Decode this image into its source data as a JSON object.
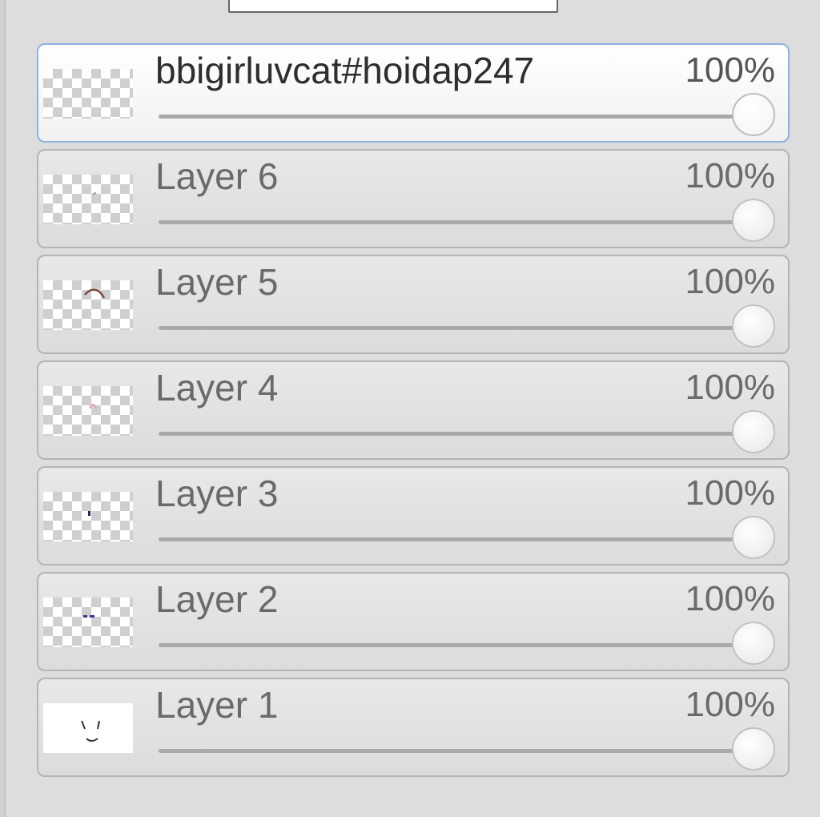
{
  "layers_panel": {
    "layers": [
      {
        "name": "bbigirluvcat#hoidap247",
        "opacity_label": "100%",
        "opacity": 1.0,
        "active": true,
        "thumb_icon": "empty-transparent"
      },
      {
        "name": "Layer 6",
        "opacity_label": "100%",
        "opacity": 1.0,
        "active": false,
        "thumb_icon": "tiny-mark"
      },
      {
        "name": "Layer 5",
        "opacity_label": "100%",
        "opacity": 1.0,
        "active": false,
        "thumb_icon": "brown-stroke"
      },
      {
        "name": "Layer 4",
        "opacity_label": "100%",
        "opacity": 1.0,
        "active": false,
        "thumb_icon": "pink-stroke"
      },
      {
        "name": "Layer 3",
        "opacity_label": "100%",
        "opacity": 1.0,
        "active": false,
        "thumb_icon": "dark-dot"
      },
      {
        "name": "Layer 2",
        "opacity_label": "100%",
        "opacity": 1.0,
        "active": false,
        "thumb_icon": "blue-marks"
      },
      {
        "name": "Layer 1",
        "opacity_label": "100%",
        "opacity": 1.0,
        "active": false,
        "thumb_icon": "face-sketch"
      }
    ]
  },
  "colors": {
    "active_border": "#8fb0e0",
    "panel_bg": "#dddddd"
  }
}
